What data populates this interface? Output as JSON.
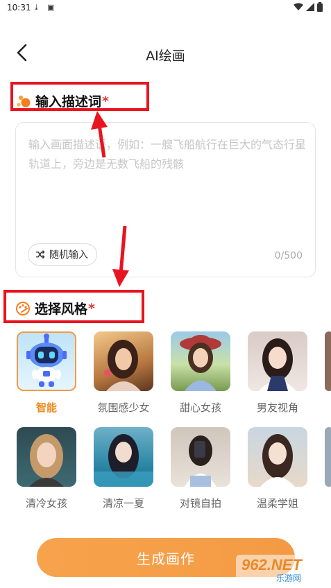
{
  "status_bar": {
    "time": "10:31"
  },
  "header": {
    "title": "AI绘画"
  },
  "description_section": {
    "title": "输入描述词",
    "required_mark": "*",
    "placeholder": "输入画面描述语，例如：一艘飞船航行在巨大的气态行星轨道上，旁边是无数飞船的残骸",
    "random_button_label": "随机输入",
    "char_counter": "0/500"
  },
  "style_section": {
    "title": "选择风格",
    "required_mark": "*",
    "styles": [
      {
        "label": "智能",
        "selected": true
      },
      {
        "label": "氛围感少女",
        "selected": false
      },
      {
        "label": "甜心女孩",
        "selected": false
      },
      {
        "label": "男友视角",
        "selected": false
      },
      {
        "label": "清冷女孩",
        "selected": false
      },
      {
        "label": "清凉一夏",
        "selected": false
      },
      {
        "label": "对镜自拍",
        "selected": false
      },
      {
        "label": "温柔学姐",
        "selected": false
      }
    ]
  },
  "generate_button_label": "生成画作",
  "watermark": {
    "top": "962.NET",
    "bottom": "乐游网"
  },
  "colors": {
    "accent": "#f49a45",
    "required": "#e53935",
    "annotation": "#e8141f"
  }
}
